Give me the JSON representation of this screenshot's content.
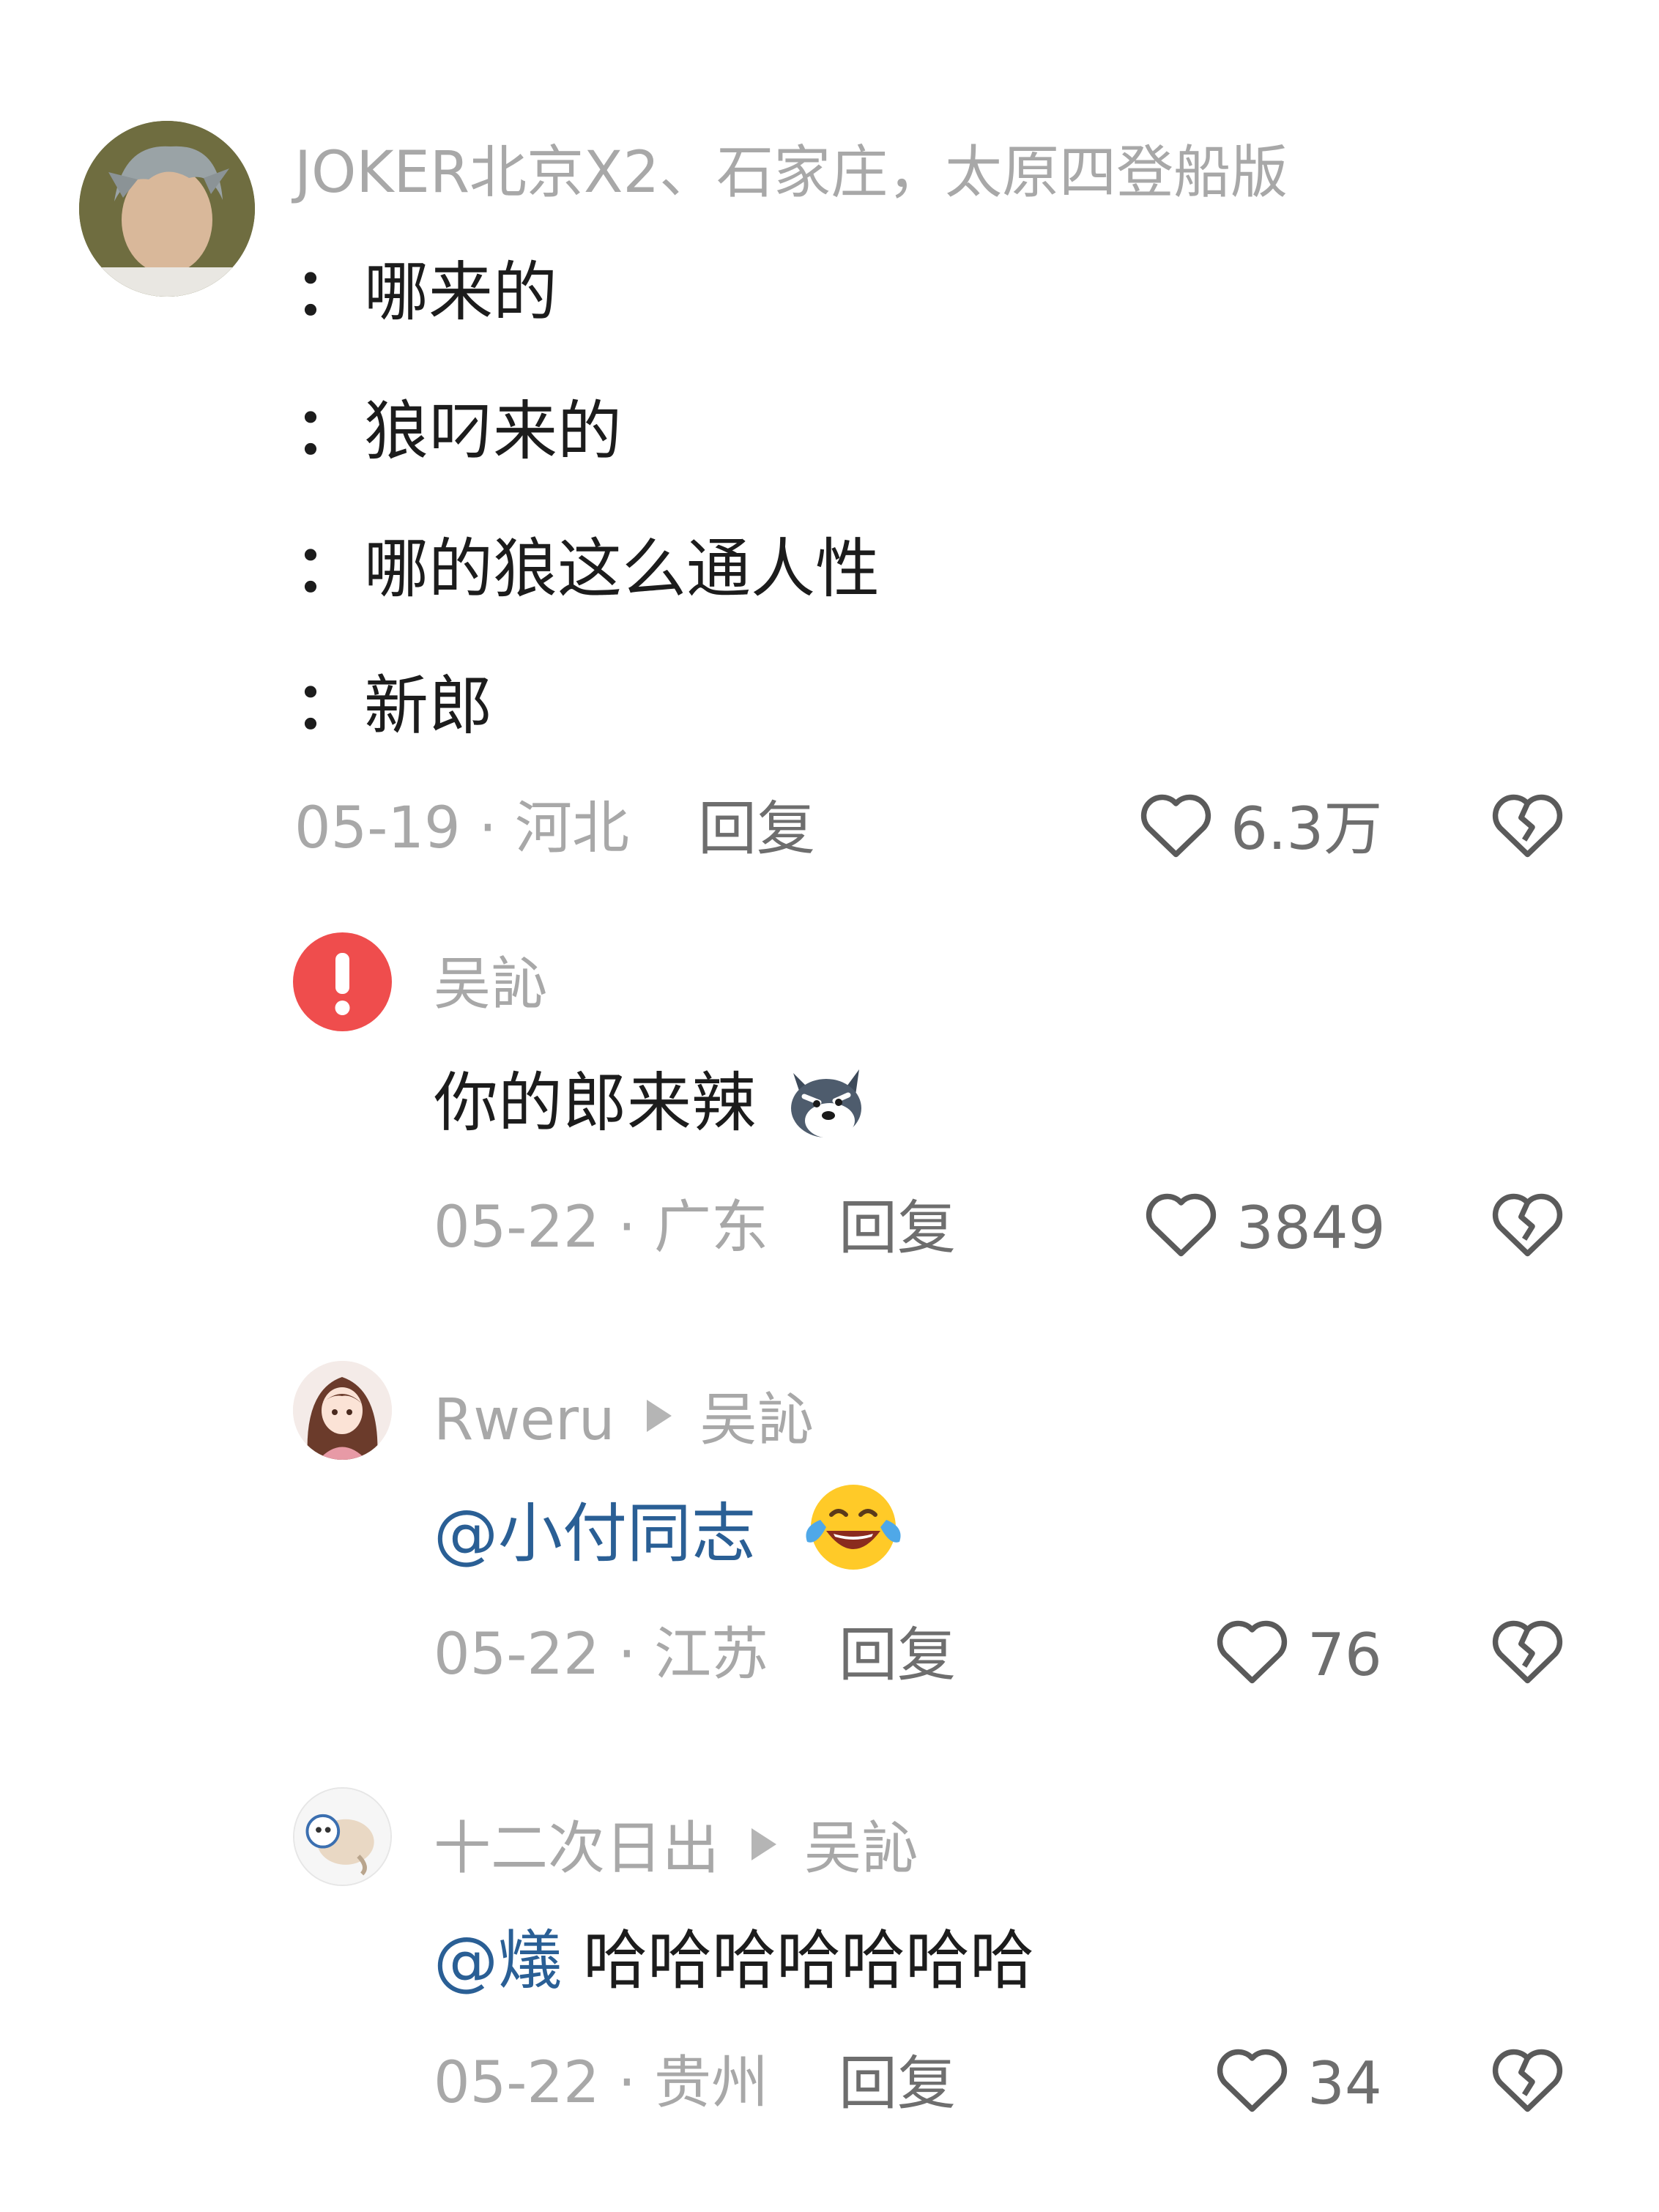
{
  "comment": {
    "author": "JOKER北京X2、石家庄，太原四登船版",
    "lines": [
      {
        "prefix": "：",
        "text": "哪来的"
      },
      {
        "prefix": "：",
        "text": "狼叼来的"
      },
      {
        "prefix": "：",
        "text": "哪的狼这么通人性"
      },
      {
        "prefix": "：",
        "text": "新郎"
      }
    ],
    "meta": "05-19 · 河北",
    "reply_label": "回复",
    "like_count": "6.3万"
  },
  "replies": [
    {
      "author": "吴訫",
      "text": "你的郎来辣",
      "meta": "05-22 · 广东",
      "reply_label": "回复",
      "like_count": "3849"
    },
    {
      "author": "Rweru",
      "reply_to": "吴訫",
      "mention": "@小付同志",
      "text": "",
      "meta": "05-22 · 江苏",
      "reply_label": "回复",
      "like_count": "76"
    },
    {
      "author": "十二次日出",
      "reply_to": "吴訫",
      "mention": "@燨",
      "text": " 哈哈哈哈哈哈哈",
      "meta": "05-22 · 贵州",
      "reply_label": "回复",
      "like_count": "34"
    }
  ],
  "icons": {
    "like": "heart-outline-icon",
    "dislike": "broken-heart-icon",
    "warning": "exclamation-icon",
    "wolf_emoji": "wolf-emoji-icon",
    "laugh_emoji": "tears-of-joy-emoji-icon",
    "reply_arrow": "play-arrow-icon"
  },
  "colors": {
    "mention": "#2a5f95",
    "meta_gray": "#a8a8a8",
    "warning_red": "#ef4d4d"
  }
}
